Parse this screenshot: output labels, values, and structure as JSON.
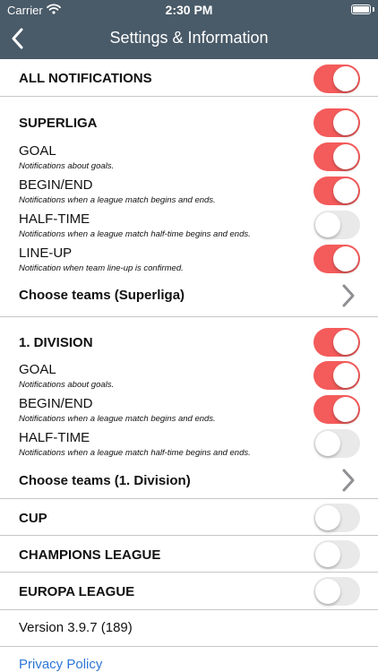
{
  "status": {
    "carrier": "Carrier",
    "time": "2:30 PM"
  },
  "nav": {
    "title": "Settings & Information"
  },
  "all_notifications": {
    "label": "ALL NOTIFICATIONS",
    "on": true
  },
  "superliga": {
    "label": "SUPERLIGA",
    "on": true,
    "options": [
      {
        "title": "GOAL",
        "desc": "Notifications about goals.",
        "on": true
      },
      {
        "title": "BEGIN/END",
        "desc": "Notifications when a league match begins and ends.",
        "on": true
      },
      {
        "title": "HALF-TIME",
        "desc": "Notifications when a league match half-time begins and ends.",
        "on": false
      },
      {
        "title": "LINE-UP",
        "desc": "Notification when team line-up is confirmed.",
        "on": true
      }
    ],
    "choose_teams": "Choose teams (Superliga)"
  },
  "division": {
    "label": "1. DIVISION",
    "on": true,
    "options": [
      {
        "title": "GOAL",
        "desc": "Notifications about goals.",
        "on": true
      },
      {
        "title": "BEGIN/END",
        "desc": "Notifications when a league match begins and ends.",
        "on": true
      },
      {
        "title": "HALF-TIME",
        "desc": "Notifications when a league match half-time begins and ends.",
        "on": false
      }
    ],
    "choose_teams": "Choose teams (1. Division)"
  },
  "cup": {
    "label": "CUP",
    "on": false
  },
  "champions_league": {
    "label": "CHAMPIONS LEAGUE",
    "on": false
  },
  "europa_league": {
    "label": "EUROPA LEAGUE",
    "on": false
  },
  "version": "Version 3.9.7 (189)",
  "privacy_policy": "Privacy Policy",
  "colors": {
    "header": "#495a68",
    "toggle_on": "#f45b5b",
    "toggle_off": "#e9e9ea",
    "link": "#2a78d5"
  }
}
